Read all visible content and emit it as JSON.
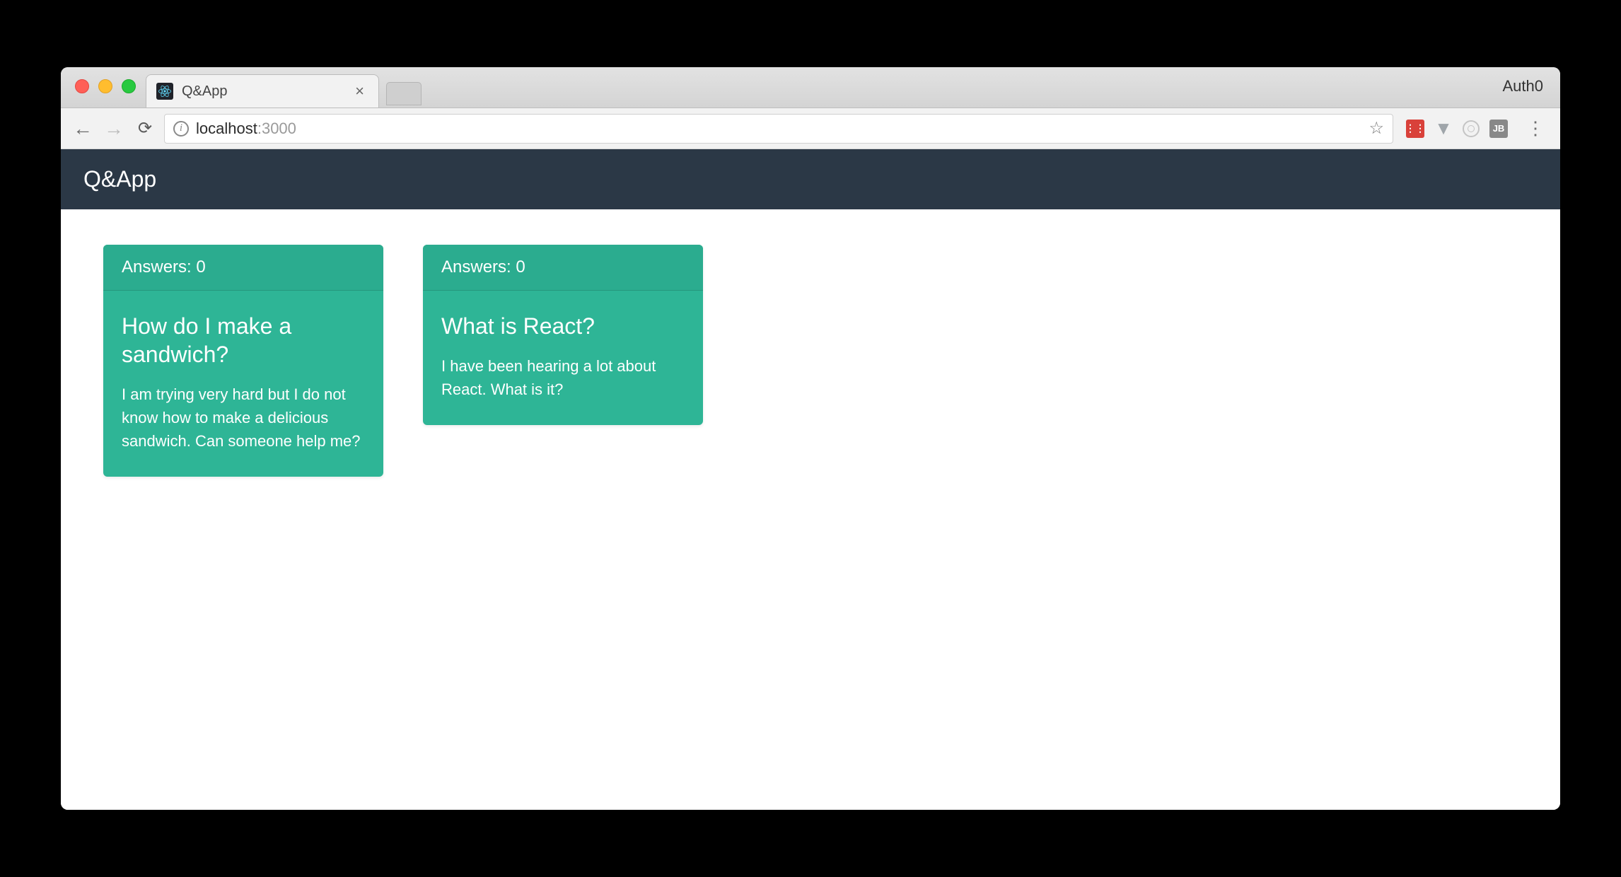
{
  "browser": {
    "tab_title": "Q&App",
    "profile_label": "Auth0",
    "url_host": "localhost",
    "url_port": ":3000"
  },
  "app": {
    "brand": "Q&App",
    "answers_prefix": "Answers: ",
    "cards": [
      {
        "answers": 0,
        "title": "How do I make a sandwich?",
        "body": "I am trying very hard but I do not know how to make a delicious sandwich. Can someone help me?"
      },
      {
        "answers": 0,
        "title": "What is React?",
        "body": "I have been hearing a lot about React. What is it?"
      }
    ]
  }
}
